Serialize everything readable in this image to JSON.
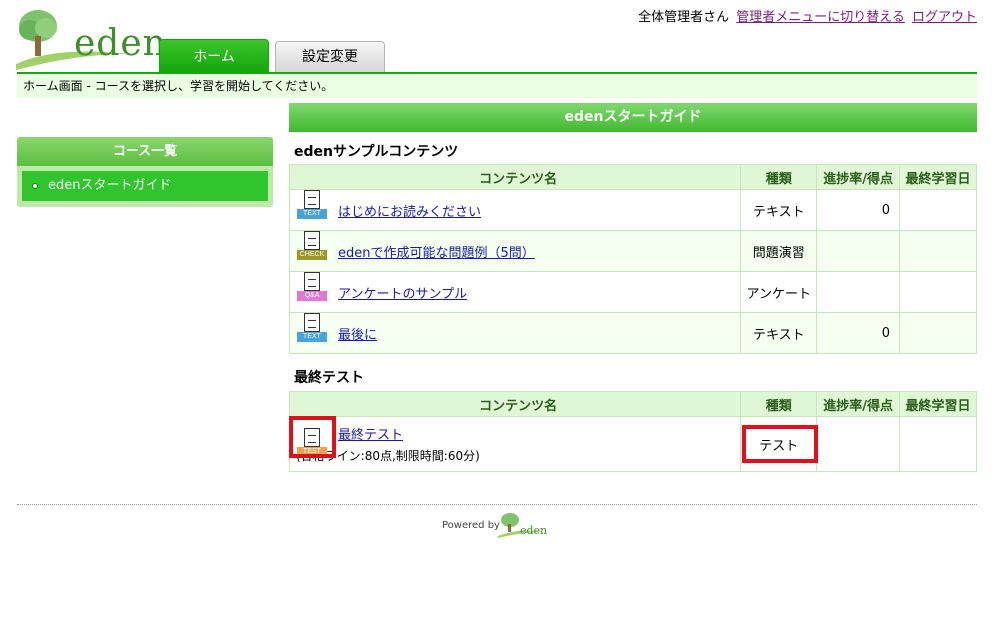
{
  "header": {
    "logo_text": "eden",
    "user_name": "全体管理者さん",
    "admin_menu_link": "管理者メニューに切り替える",
    "logout_link": "ログアウト"
  },
  "tabs": [
    {
      "label": "ホーム",
      "active": true
    },
    {
      "label": "設定変更",
      "active": false
    }
  ],
  "breadcrumb": "ホーム画面 - コースを選択し、学習を開始してください。",
  "sidebar": {
    "title": "コース一覧",
    "items": [
      {
        "label": "edenスタートガイド",
        "selected": true
      }
    ]
  },
  "main": {
    "banner": "edenスタートガイド",
    "columns": {
      "name": "コンテンツ名",
      "type": "種類",
      "progress": "進捗率/得点",
      "last_date": "最終学習日"
    },
    "sections": [
      {
        "title": "edenサンプルコンテンツ",
        "rows": [
          {
            "icon": "text-doc-icon",
            "tag": "TEXT",
            "tag_color": "#4aa3d8",
            "name": "はじめにお読みください",
            "type": "テキスト",
            "progress": "0",
            "last_date": ""
          },
          {
            "icon": "check-doc-icon",
            "tag": "CHECK",
            "tag_color": "#9a9a2a",
            "name": "edenで作成可能な問題例（5問）",
            "type": "問題演習",
            "progress": "",
            "last_date": ""
          },
          {
            "icon": "qa-doc-icon",
            "tag": "Q&A",
            "tag_color": "#e27ad2",
            "name": "アンケートのサンプル",
            "type": "アンケート",
            "progress": "",
            "last_date": ""
          },
          {
            "icon": "text-doc-icon",
            "tag": "TEXT",
            "tag_color": "#4aa3d8",
            "name": "最後に",
            "type": "テキスト",
            "progress": "0",
            "last_date": ""
          }
        ]
      },
      {
        "title": "最終テスト",
        "rows": [
          {
            "icon": "test-doc-icon",
            "tag": "TEST",
            "tag_color": "#f0a050",
            "name": "最終テスト",
            "sub": "(合格ライン:80点,制限時間:60分)",
            "type": "テスト",
            "progress": "",
            "last_date": ""
          }
        ]
      }
    ]
  },
  "footer": {
    "powered_by": "Powered by",
    "logo_text": "eden"
  },
  "colors": {
    "brand_green": "#1ba412",
    "highlight_red": "#e0101b"
  }
}
